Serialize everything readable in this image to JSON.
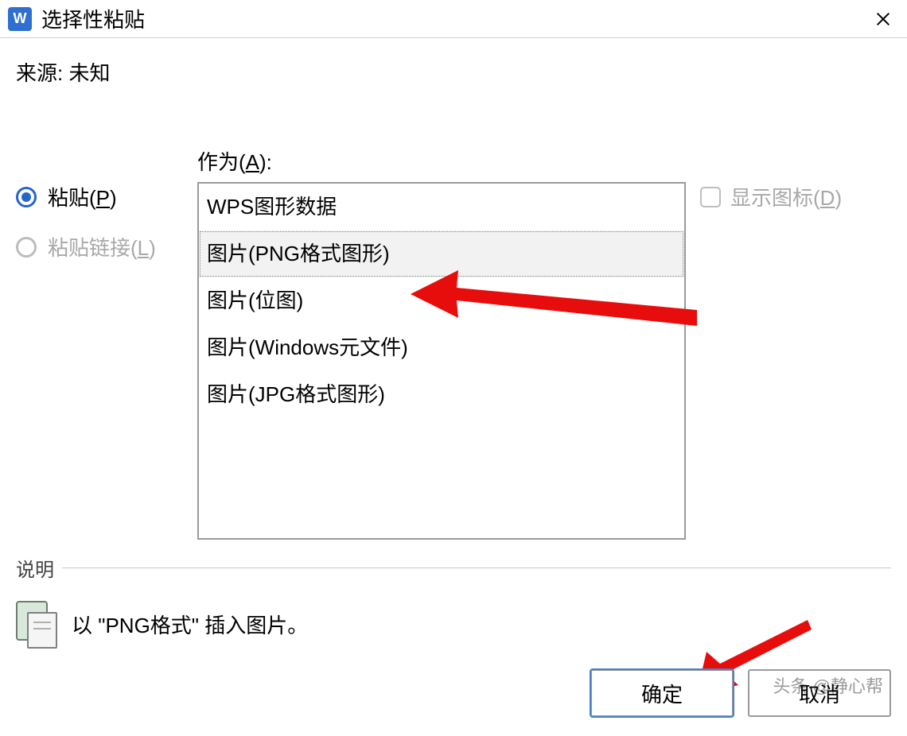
{
  "titlebar": {
    "app_icon_letter": "W",
    "title": "选择性粘贴"
  },
  "source": {
    "label": "来源:",
    "value": "未知"
  },
  "as_label": "作为(A):",
  "radios": {
    "paste": {
      "label": "粘贴(P)",
      "selected": true,
      "enabled": true
    },
    "paste_link": {
      "label": "粘贴链接(L)",
      "selected": false,
      "enabled": false
    }
  },
  "listbox": {
    "items": [
      "WPS图形数据",
      "图片(PNG格式图形)",
      "图片(位图)",
      "图片(Windows元文件)",
      "图片(JPG格式图形)"
    ],
    "selected_index": 1
  },
  "show_icon": {
    "label": "显示图标(D)",
    "checked": false,
    "enabled": false
  },
  "description": {
    "header": "说明",
    "text": "以 \"PNG格式\" 插入图片。"
  },
  "buttons": {
    "ok": "确定",
    "cancel": "取消"
  },
  "watermark": "头条 @静心帮"
}
